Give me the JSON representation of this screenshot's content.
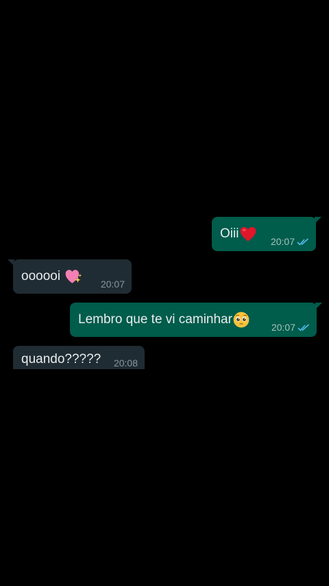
{
  "conversation": {
    "messages": [
      {
        "direction": "outgoing",
        "text": "Oiii",
        "emoji": "red-heart-icon",
        "time": "20:07",
        "status": "read"
      },
      {
        "direction": "incoming",
        "text": "oooooi",
        "emoji": "sparkling-heart-icon",
        "time": "20:07"
      },
      {
        "direction": "outgoing",
        "text": "Lembro que te vi caminhar",
        "emoji": "pleading-face-icon",
        "time": "20:07",
        "status": "read"
      },
      {
        "direction": "incoming",
        "text": "quando?????",
        "time": "20:08"
      }
    ]
  },
  "theme": {
    "background": "#000000",
    "outgoing_bubble": "#005c4b",
    "incoming_bubble": "#202c33",
    "read_tick": "#53bdeb"
  }
}
